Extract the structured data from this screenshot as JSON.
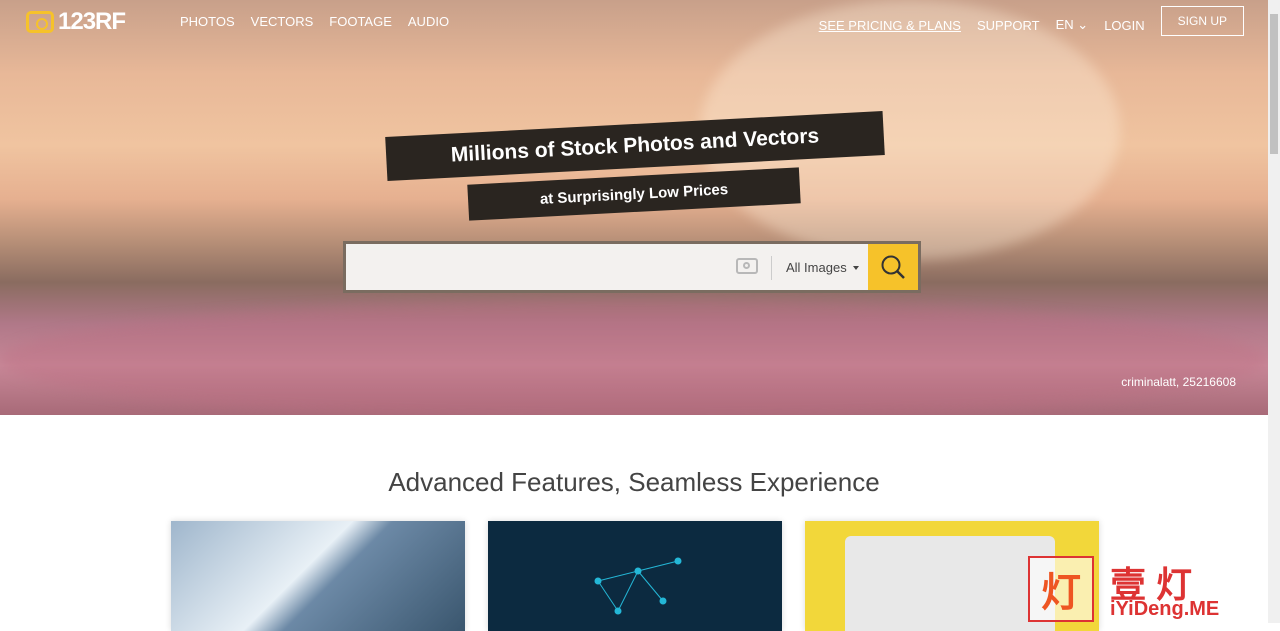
{
  "logo": {
    "text": "123RF"
  },
  "nav": {
    "left": [
      "PHOTOS",
      "VECTORS",
      "FOOTAGE",
      "AUDIO"
    ],
    "pricing": "SEE PRICING & PLANS",
    "support": "SUPPORT",
    "lang": "EN",
    "login": "LOGIN",
    "signup": "SIGN UP"
  },
  "hero": {
    "title": "Millions of Stock Photos and Vectors",
    "subtitle": "at Surprisingly Low Prices",
    "search_placeholder": "",
    "filter": "All Images",
    "credit": "criminalatt, 25216608"
  },
  "section": {
    "heading": "Advanced Features, Seamless Experience"
  },
  "watermark": {
    "char": "灯",
    "text": "壹 灯",
    "site": "iYiDeng.ME"
  },
  "colors": {
    "accent": "#f6c22a",
    "banner": "#2a2520"
  }
}
